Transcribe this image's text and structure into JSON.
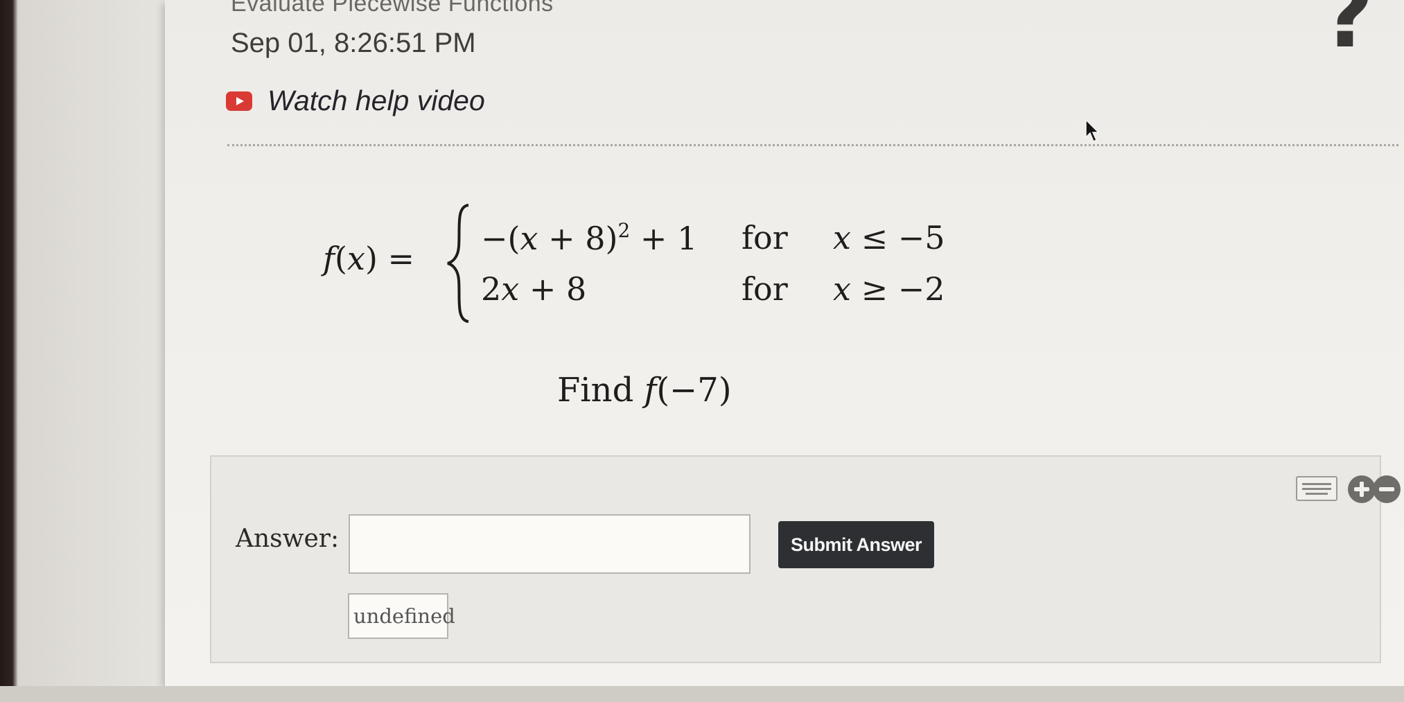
{
  "header": {
    "assignment_title": "Evaluate Piecewise Functions",
    "timestamp": "Sep 01, 8:26:51 PM",
    "help_video_label": "Watch help video",
    "help_icon": "question-mark-icon"
  },
  "problem": {
    "function_name": "f(x) =",
    "cases": [
      {
        "expression": "−(x + 8)² + 1",
        "keyword": "for",
        "condition": "x ≤ −5"
      },
      {
        "expression": "2x + 8",
        "keyword": "for",
        "condition": "x ≥ −2"
      }
    ],
    "question": "Find f(−7)"
  },
  "answer": {
    "label": "Answer:",
    "value": "",
    "submit_label": "Submit Answer",
    "undefined_label": "undefined"
  },
  "toolbar": {
    "keyboard_icon": "keyboard-icon",
    "zoom_in_icon": "plus-circle-icon",
    "zoom_out_icon": "minus-circle-icon"
  },
  "colors": {
    "video_icon": "#d93a34",
    "submit_bg": "#2d2f33",
    "text": "#1f1d1c"
  }
}
